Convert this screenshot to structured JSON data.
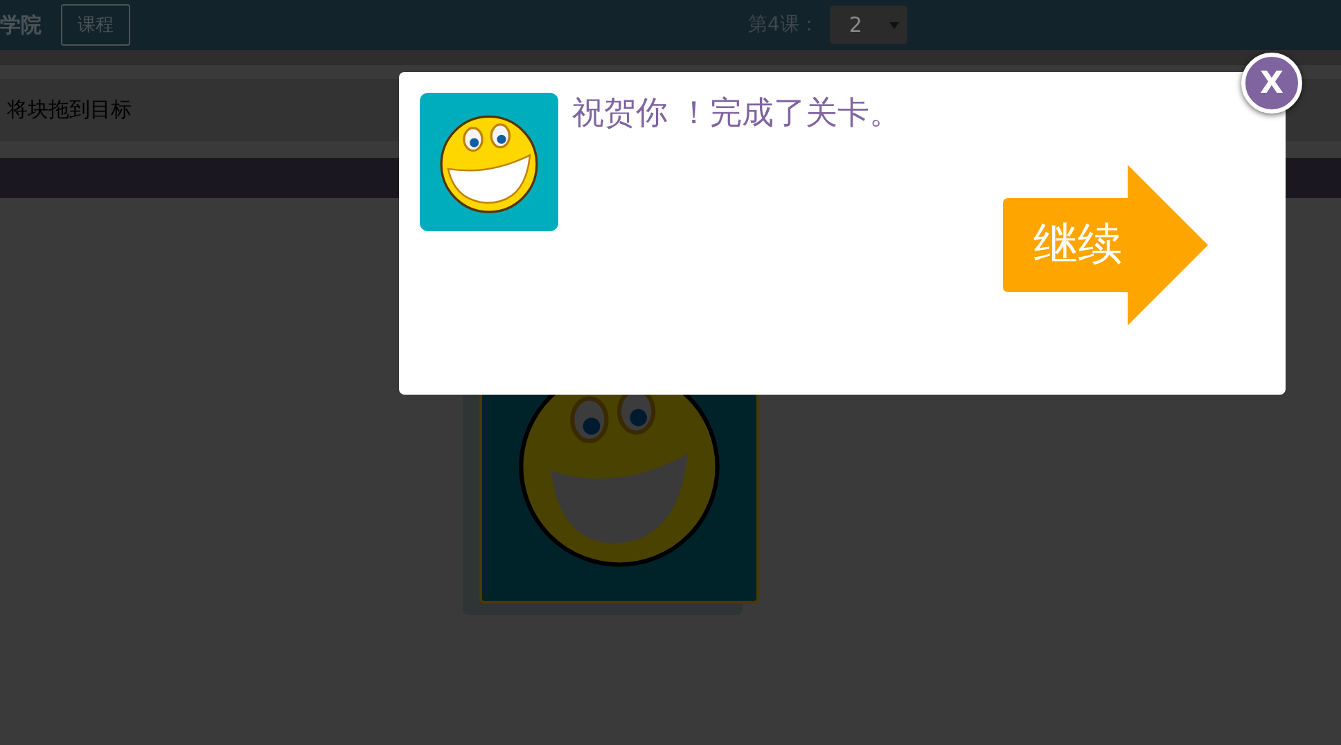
{
  "header": {
    "brand": "学院",
    "course_button": "课程",
    "lesson_label": "第4课：",
    "lesson_select": {
      "value": "2"
    }
  },
  "instruction": "将块拖到目标",
  "dialog": {
    "message": "祝贺你 ！完成了关卡。",
    "continue_button": "继续",
    "close_button": "X"
  }
}
